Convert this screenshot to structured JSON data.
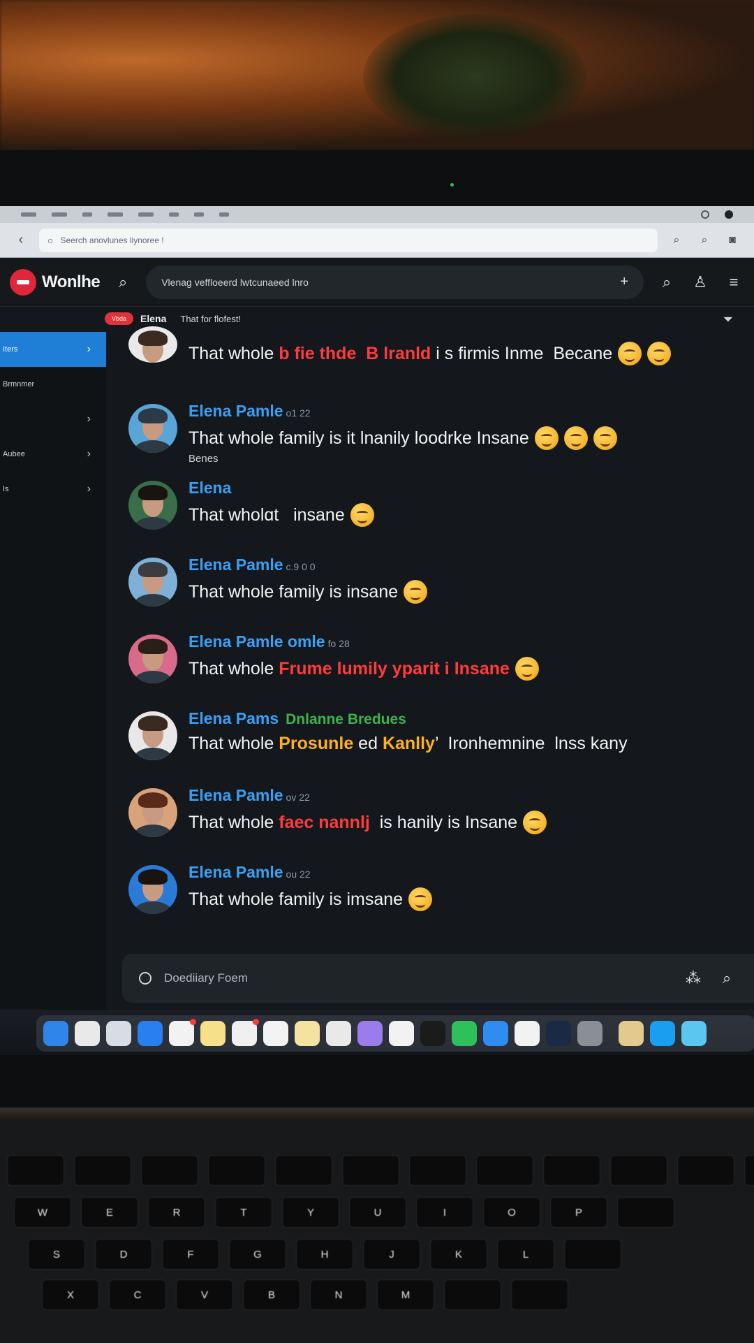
{
  "browser": {
    "url_text": "Seerch anovlunes liynoree !",
    "back_icon": "chevron-left-icon"
  },
  "app": {
    "name": "Wonlhe",
    "search_placeholder": "Vlenag veffloeerd lwtcunaeed lnro",
    "plus_label": "+"
  },
  "channel": {
    "live_label": "Vbda",
    "name": "Elena",
    "topic": "That for flofest!"
  },
  "messages": [
    {
      "name": "",
      "time": "",
      "segments": [
        {
          "t": "That whole ",
          "c": ""
        },
        {
          "t": "b fie thde  B lranld",
          "c": "red"
        },
        {
          "t": " i s firmis Inme  Becane",
          "c": ""
        }
      ],
      "emojis": 2
    },
    {
      "name": "Elena  Pamle",
      "time": "o1 22",
      "segments": [
        {
          "t": "That whole family is it lnanily loodrke Insane",
          "c": ""
        }
      ],
      "emojis": 3,
      "sub": "Benes"
    },
    {
      "name": "Elena",
      "time": "",
      "segments": [
        {
          "t": "That wholɑt   insane",
          "c": ""
        }
      ],
      "emojis": 1
    },
    {
      "name": "Elena  Pamle",
      "time": "c.9 0 0",
      "segments": [
        {
          "t": "That whole family is insane",
          "c": ""
        }
      ],
      "emojis": 1
    },
    {
      "name": "Elena  Pamle omle",
      "time": "fo 28",
      "segments": [
        {
          "t": "That whole ",
          "c": ""
        },
        {
          "t": "Frume lumily yparit i Insane",
          "c": "red"
        }
      ],
      "emojis": 1
    },
    {
      "name": "Elena  Pams",
      "green": "Dnlanne  Bredues",
      "time": "",
      "segments": [
        {
          "t": "That whole ",
          "c": ""
        },
        {
          "t": "Prosunle",
          "c": "orange"
        },
        {
          "t": " ed ",
          "c": ""
        },
        {
          "t": "Kanlly",
          "c": "orange"
        },
        {
          "t": "’  Ironhemnine  lnss kany",
          "c": ""
        }
      ],
      "emojis": 0
    },
    {
      "name": "Elena  Pamle",
      "time": "ov 22",
      "segments": [
        {
          "t": "That whole ",
          "c": ""
        },
        {
          "t": "faec nannlj",
          "c": "red"
        },
        {
          "t": "  is hanily is Insane",
          "c": ""
        }
      ],
      "emojis": 1
    },
    {
      "name": "Elena  Pamle",
      "time": "ou 22",
      "segments": [
        {
          "t": "That whole family is imsane",
          "c": ""
        }
      ],
      "emojis": 1
    }
  ],
  "sidebar": [
    "Iters",
    "Brmnmer",
    "",
    "Aubee",
    "Is"
  ],
  "composer": {
    "placeholder": "Doediiary Foem"
  },
  "dock_colors": [
    "#2f86e8",
    "#e9e9e9",
    "#d6dde4",
    "#2a7ff0",
    "#f2f2f2",
    "#f7e08a",
    "#f0f0f0",
    "#f3f3f3",
    "#f4e3a0",
    "#e9e9e9",
    "#9c7bea",
    "#f2f2f2",
    "#1b1b1b",
    "#2ec05a",
    "#2f8cf0",
    "#f2f2f2",
    "#1a2a44",
    "#8a8f95",
    "#e3c98e",
    "#1a9ff0",
    "#5bc6f0"
  ],
  "keyboard_rows": [
    [
      "",
      "",
      "",
      "",
      "",
      "",
      "",
      "",
      "",
      "",
      "",
      "",
      ""
    ],
    [
      "W",
      "E",
      "R",
      "T",
      "Y",
      "U",
      "I",
      "O",
      "P",
      ""
    ],
    [
      "S",
      "D",
      "F",
      "G",
      "H",
      "J",
      "K",
      "L",
      ""
    ],
    [
      "X",
      "C",
      "V",
      "B",
      "N",
      "M",
      "",
      ""
    ]
  ]
}
